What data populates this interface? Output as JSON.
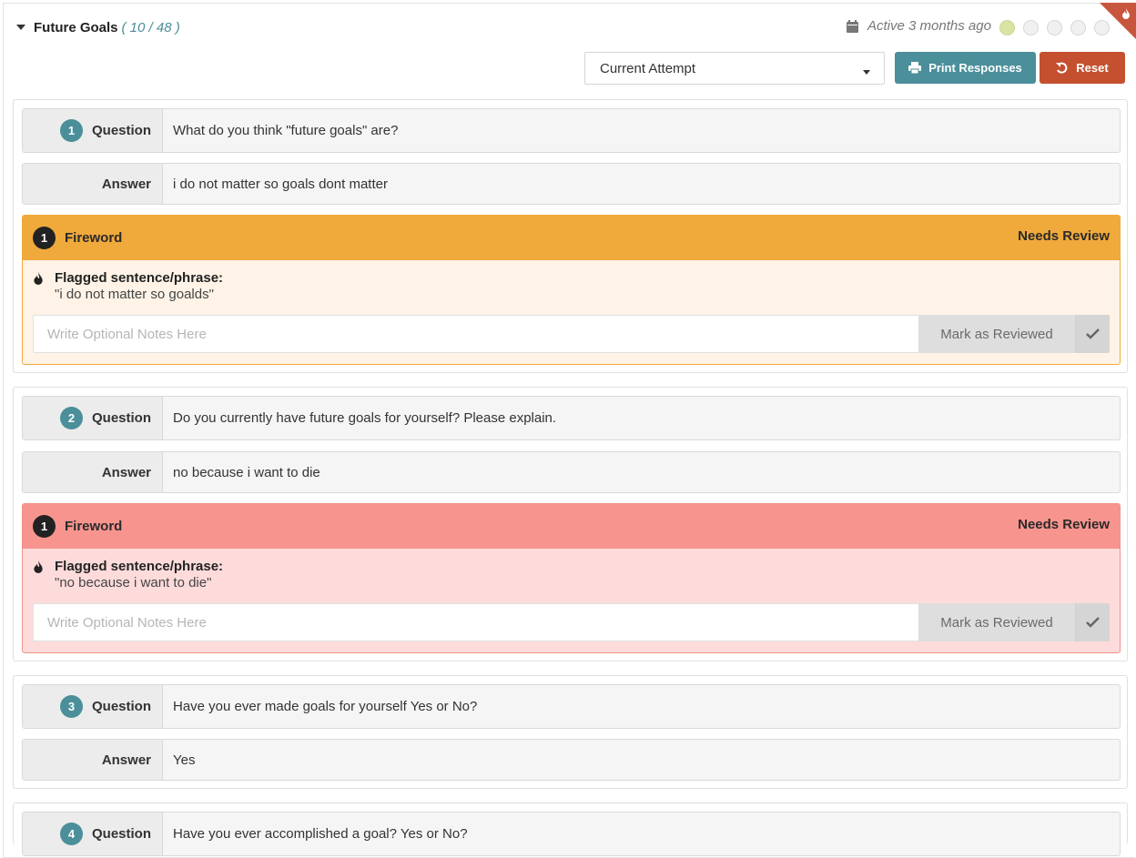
{
  "section": {
    "title": "Future Goals",
    "count": "( 10 / 48 )",
    "activity": "Active 3 months ago",
    "progress_dots": [
      true,
      false,
      false,
      false,
      false
    ]
  },
  "controls": {
    "attempt_select": "Current Attempt",
    "print_label": "Print Responses",
    "reset_label": "Reset"
  },
  "labels": {
    "question": "Question",
    "answer": "Answer",
    "fireword": "Fireword",
    "needs_review": "Needs Review",
    "flagged_title": "Flagged sentence/phrase:",
    "notes_placeholder": "Write Optional Notes Here",
    "mark_reviewed": "Mark as Reviewed"
  },
  "items": [
    {
      "number": "1",
      "question": "What do you think \"future goals\" are?",
      "answer": "i do not matter so goals dont matter",
      "fireword": {
        "count": "1",
        "phrase": "\"i do not matter so goalds\"",
        "severity_color": "#f0a93b"
      }
    },
    {
      "number": "2",
      "question": "Do you currently have future goals for yourself? Please explain.",
      "answer": "no because i want to die",
      "fireword": {
        "count": "1",
        "phrase": "\"no because i want to die\"",
        "severity_color": "#f8948e"
      }
    },
    {
      "number": "3",
      "question": "Have you ever made goals for yourself Yes or No?",
      "answer": "Yes"
    },
    {
      "number": "4",
      "question": "Have you ever accomplished a goal? Yes or No?"
    }
  ],
  "colors": {
    "accent_teal": "#4a8f9a",
    "reset_red": "#c4502f",
    "flag_orange": "#f0a93b",
    "flag_red": "#f8948e"
  }
}
